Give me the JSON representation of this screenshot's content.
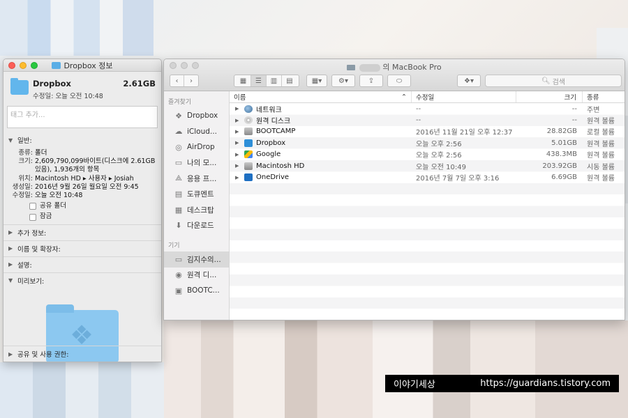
{
  "info_window": {
    "title": "Dropbox 정보",
    "name": "Dropbox",
    "size": "2.61GB",
    "modified_line": "수정일:  오늘 오전 10:48",
    "tags_placeholder": "태그 추가...",
    "general_header": "일반:",
    "general": {
      "kind_k": "종류:",
      "kind_v": "폴더",
      "size_k": "크기:",
      "size_v": "2,609,790,099바이트(디스크에 2.61GB 있음), 1,936개의 항목",
      "where_k": "위치:",
      "where_v": "Macintosh HD ▸ 사용자 ▸ Josiah",
      "created_k": "생성일:",
      "created_v": "2016년 9월 26일 월요일 오전 9:45",
      "modified_k": "수정일:",
      "modified_v": "오늘 오전 10:48",
      "shared_folder": "공유 폴더",
      "locked": "잠금"
    },
    "sections": [
      "추가 정보:",
      "이름 및 확장자:",
      "설명:",
      "미리보기:"
    ],
    "sharing_header": "공유 및 사용 권한:"
  },
  "finder": {
    "title": "의 MacBook Pro",
    "search_placeholder": "검색",
    "sidebar": {
      "favorites_header": "즐겨찾기",
      "favorites": [
        {
          "label": "Dropbox",
          "icon": "dropbox-icon"
        },
        {
          "label": "iCloud...",
          "icon": "cloud-icon"
        },
        {
          "label": "AirDrop",
          "icon": "airdrop-icon"
        },
        {
          "label": "나의 모...",
          "icon": "files-icon"
        },
        {
          "label": "응용 프...",
          "icon": "apps-icon"
        },
        {
          "label": "도큐멘트",
          "icon": "document-icon"
        },
        {
          "label": "데스크탑",
          "icon": "desktop-icon"
        },
        {
          "label": "다운로드",
          "icon": "download-icon"
        }
      ],
      "devices_header": "기기",
      "devices": [
        {
          "label": "김지수의...",
          "icon": "laptop-icon"
        },
        {
          "label": "원격 디...",
          "icon": "disc-icon"
        },
        {
          "label": "BOOTC...",
          "icon": "drive-icon"
        }
      ]
    },
    "columns": {
      "name": "이름",
      "date": "수정일",
      "size": "크기",
      "kind": "종류"
    },
    "rows": [
      {
        "name": "네트워크",
        "date": "--",
        "size": "--",
        "kind": "주변",
        "icon": "globe"
      },
      {
        "name": "원격 디스크",
        "date": "--",
        "size": "--",
        "kind": "원격 볼륨",
        "icon": "disk"
      },
      {
        "name": "BOOTCAMP",
        "date": "2016년 11월 21일 오후 12:37",
        "size": "28.82GB",
        "kind": "로컬 볼륨",
        "icon": "hd"
      },
      {
        "name": "Dropbox",
        "date": "오늘 오후 2:56",
        "size": "5.01GB",
        "kind": "원격 볼륨",
        "icon": "db"
      },
      {
        "name": "Google",
        "date": "오늘 오후 2:56",
        "size": "438.3MB",
        "kind": "원격 볼륨",
        "icon": "google"
      },
      {
        "name": "Macintosh HD",
        "date": "오늘 오전 10:49",
        "size": "203.92GB",
        "kind": "시동 볼륨",
        "icon": "hd"
      },
      {
        "name": "OneDrive",
        "date": "2016년 7월 7일 오후 3:16",
        "size": "6.69GB",
        "kind": "원격 볼륨",
        "icon": "od"
      }
    ]
  },
  "watermark": {
    "left": "이야기세상",
    "right": "https://guardians.tistory.com"
  }
}
